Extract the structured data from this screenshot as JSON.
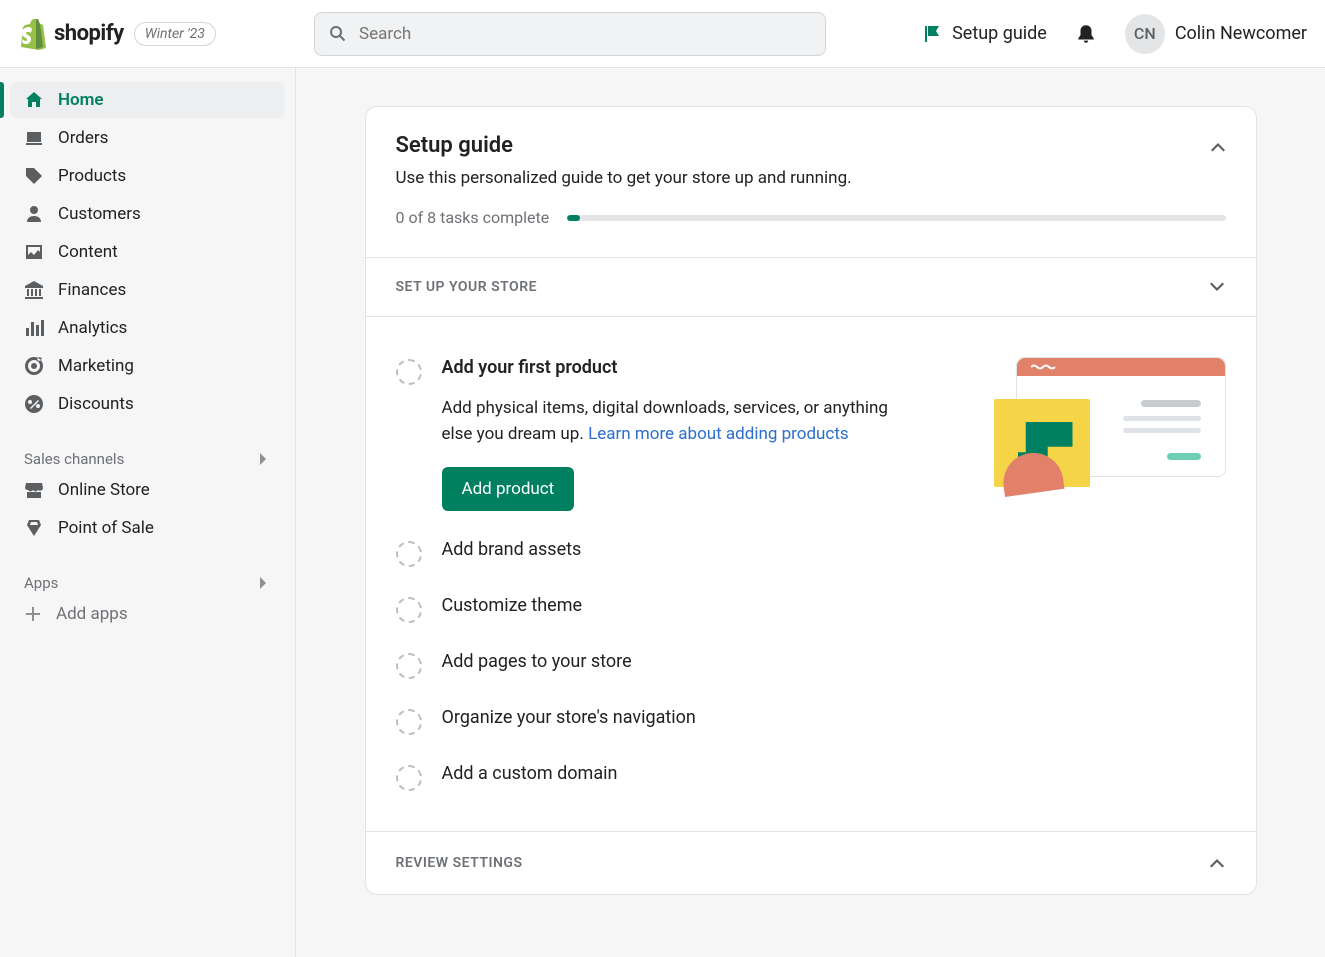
{
  "header": {
    "brand": "shopify",
    "badge": "Winter '23",
    "search_placeholder": "Search",
    "setup_guide": "Setup guide",
    "user_initials": "CN",
    "user_name": "Colin Newcomer"
  },
  "sidebar": {
    "items": [
      {
        "label": "Home"
      },
      {
        "label": "Orders"
      },
      {
        "label": "Products"
      },
      {
        "label": "Customers"
      },
      {
        "label": "Content"
      },
      {
        "label": "Finances"
      },
      {
        "label": "Analytics"
      },
      {
        "label": "Marketing"
      },
      {
        "label": "Discounts"
      }
    ],
    "channels_header": "Sales channels",
    "channels": [
      {
        "label": "Online Store"
      },
      {
        "label": "Point of Sale"
      }
    ],
    "apps_header": "Apps",
    "add_apps": "Add apps"
  },
  "setup": {
    "title": "Setup guide",
    "subtitle": "Use this personalized guide to get your store up and running.",
    "progress_text": "0 of 8 tasks complete",
    "section1_label": "SET UP YOUR STORE",
    "tasks": [
      {
        "title": "Add your first product"
      },
      {
        "title": "Add brand assets"
      },
      {
        "title": "Customize theme"
      },
      {
        "title": "Add pages to your store"
      },
      {
        "title": "Organize your store's navigation"
      },
      {
        "title": "Add a custom domain"
      }
    ],
    "active_task": {
      "description": "Add physical items, digital downloads, services, or anything else you dream up. ",
      "link_text": "Learn more about adding products",
      "button": "Add product"
    },
    "section2_label": "REVIEW SETTINGS"
  }
}
